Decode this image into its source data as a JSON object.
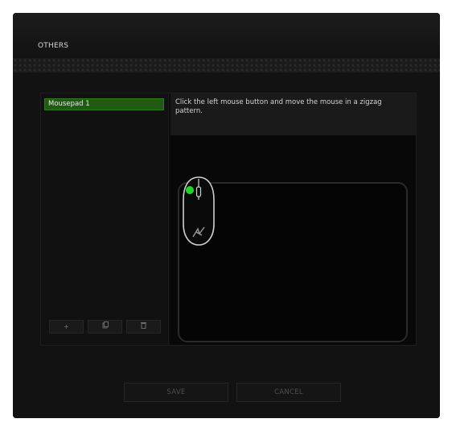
{
  "window": {
    "title": "OTHERS"
  },
  "profiles": {
    "items": [
      {
        "label": "Mousepad 1",
        "selected": true
      }
    ],
    "buttons": [
      {
        "icon": "plus-icon",
        "glyph": "+"
      },
      {
        "icon": "copy-icon",
        "glyph": "❐"
      },
      {
        "icon": "delete-icon",
        "glyph": "🗑"
      }
    ]
  },
  "instructions": {
    "text": "Click the left mouse button and move the mouse in a zigzag pattern."
  },
  "footer": {
    "save_label": "SAVE",
    "cancel_label": "CANCEL"
  },
  "colors": {
    "accent": "#2d7a1e",
    "indicator": "#23d32a"
  }
}
